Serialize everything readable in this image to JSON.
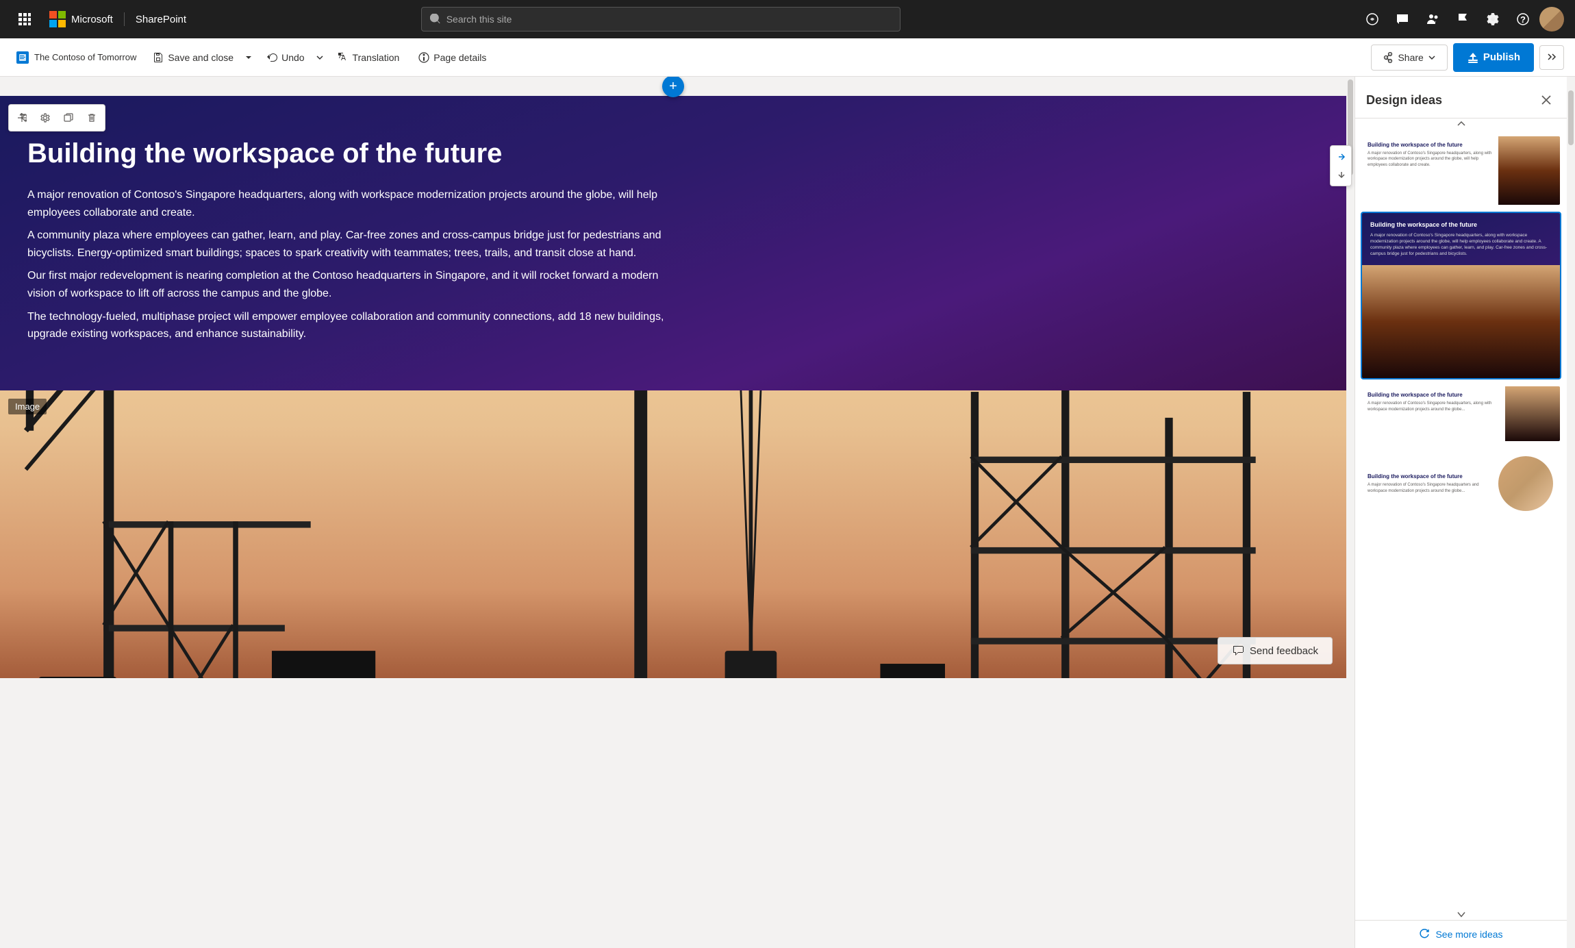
{
  "topnav": {
    "appname": "Microsoft",
    "product": "SharePoint",
    "search_placeholder": "Search this site",
    "icons": [
      "waffle",
      "account",
      "chat",
      "people",
      "flag",
      "settings",
      "help",
      "avatar"
    ]
  },
  "toolbar": {
    "page_name": "The Contoso of Tomorrow",
    "save_close_label": "Save and close",
    "undo_label": "Undo",
    "translation_label": "Translation",
    "page_details_label": "Page details",
    "share_label": "Share",
    "publish_label": "Publish"
  },
  "canvas": {
    "add_section_label": "+",
    "hero": {
      "title": "Building the workspace of the future",
      "body_paragraphs": [
        "A major renovation of Contoso's Singapore headquarters, along with workspace modernization projects around the globe, will help employees collaborate and create.",
        "A community plaza where employees can gather, learn, and play. Car-free zones and cross-campus bridge just for pedestrians and bicyclists. Energy-optimized smart buildings; spaces to spark creativity with teammates; trees, trails, and transit close at hand.",
        "Our first major redevelopment is nearing completion at the Contoso headquarters in Singapore, and it will rocket forward a modern vision of workspace to lift off across the campus and the globe.",
        "The technology-fueled, multiphase project will empower employee collaboration and community connections, add 18 new buildings, upgrade existing workspaces, and enhance sustainability."
      ]
    },
    "image_label": "Image",
    "send_feedback_label": "Send feedback"
  },
  "design_panel": {
    "title": "Design ideas",
    "see_more_label": "See more ideas",
    "cards": [
      {
        "id": 1,
        "selected": false
      },
      {
        "id": 2,
        "selected": true
      },
      {
        "id": 3,
        "selected": false
      },
      {
        "id": 4,
        "selected": false
      }
    ]
  },
  "webpart_toolbar": {
    "move_label": "Move",
    "settings_label": "Settings",
    "duplicate_label": "Duplicate",
    "delete_label": "Delete"
  }
}
